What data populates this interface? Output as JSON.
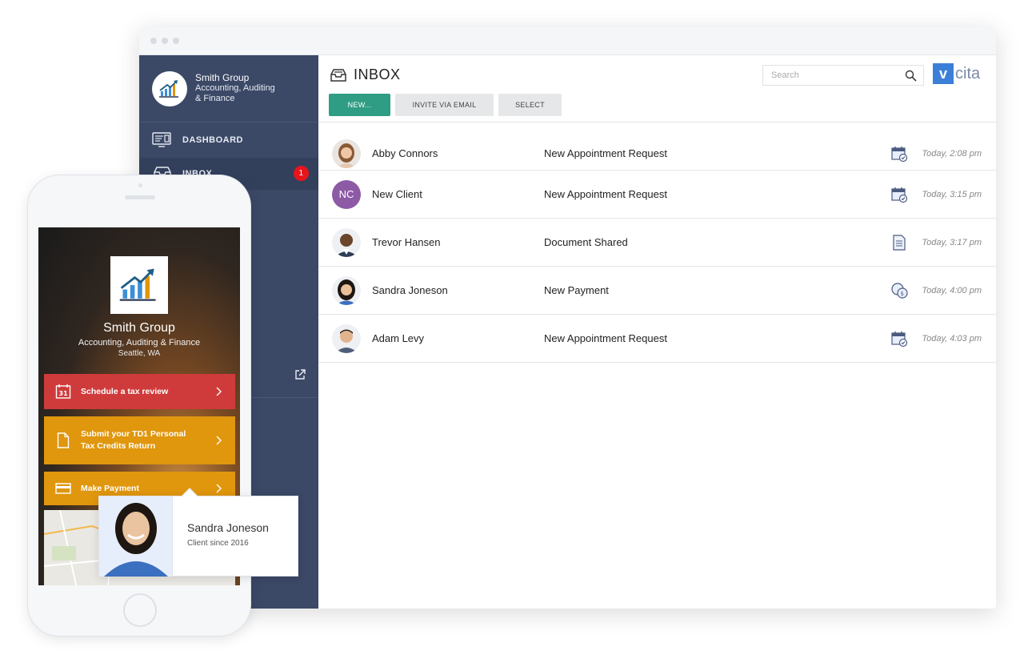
{
  "sidebar": {
    "brand": {
      "name": "Smith Group",
      "line1": "Accounting, Auditing",
      "line2": "& Finance"
    },
    "items": [
      {
        "label": "DASHBOARD"
      },
      {
        "label": "INBOX",
        "badge": "1"
      }
    ]
  },
  "header": {
    "title": "INBOX",
    "buttons": {
      "new": "NEW...",
      "invite": "INVITE VIA EMAIL",
      "select": "SELECT"
    },
    "search_placeholder": "Search",
    "logo_mark": "v",
    "logo_word": "cita"
  },
  "inbox": [
    {
      "name": "Abby Connors",
      "subject": "New Appointment Request",
      "icon": "calendar-icon",
      "time": "Today, 2:08 pm"
    },
    {
      "name": "New Client",
      "initials": "NC",
      "subject": "New Appointment Request",
      "icon": "calendar-icon",
      "time": "Today, 3:15 pm"
    },
    {
      "name": "Trevor Hansen",
      "subject": "Document Shared",
      "icon": "document-icon",
      "time": "Today, 3:17 pm"
    },
    {
      "name": "Sandra Joneson",
      "subject": "New Payment",
      "icon": "coins-icon",
      "time": "Today, 4:00 pm"
    },
    {
      "name": "Adam Levy",
      "subject": "New Appointment Request",
      "icon": "calendar-icon",
      "time": "Today, 4:03 pm"
    }
  ],
  "phone": {
    "name": "Smith Group",
    "subtitle": "Accounting, Auditing & Finance",
    "city": "Seattle, WA",
    "cards": [
      {
        "label": "Schedule a tax review",
        "calendar_day": "31"
      },
      {
        "line1": "Submit your TD1 Personal",
        "line2": "Tax Credits Return"
      },
      {
        "label": "Make Payment"
      }
    ]
  },
  "popover": {
    "name": "Sandra Joneson",
    "since": "Client since 2016"
  },
  "colors": {
    "sidebar": "#3b4866",
    "accent": "#2f9d83",
    "badge": "#e8151b",
    "card_red": "#cf3b3b",
    "card_orange": "#e0960d"
  }
}
